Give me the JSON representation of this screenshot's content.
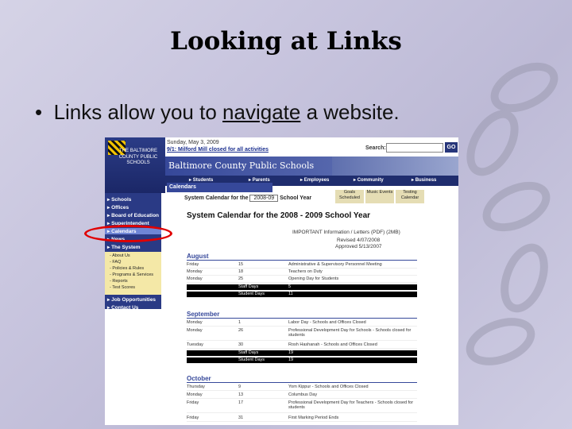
{
  "slide": {
    "title": "Looking at Links",
    "bullet_symbol": "•",
    "bullet_pre": "Links allow you to",
    "bullet_link": "navigate",
    "bullet_post": "a website."
  },
  "website": {
    "date": "Sunday, May 3, 2009",
    "alert": "9/1: Milford Mill closed for all activities",
    "search_label": "Search:",
    "search_value": "",
    "go_label": "GO",
    "logo_text": "THE BALTIMORE COUNTY PUBLIC SCHOOLS",
    "banner_title": "Baltimore County Public Schools",
    "tabs": [
      "Students",
      "Parents",
      "Employees",
      "Community",
      "Business"
    ],
    "section_title": "Calendars",
    "subtabs": [
      "Goals Scheduled",
      "Music Events",
      "Testing Calendar"
    ],
    "sidebar_items": [
      "Schools",
      "Offices",
      "Board of Education",
      "Superintendent",
      "Calendars",
      "News",
      "The System",
      "Job Opportunities",
      "Contact Us"
    ],
    "sidebar_subitems": [
      "About Us",
      "FAQ",
      "Policies & Rules",
      "Programs & Services",
      "Reports",
      "Test Scores"
    ],
    "calendar_select_label": "System Calendar for the",
    "calendar_select_value": "2008-09",
    "calendar_select_suffix": "School Year",
    "doc_title": "System Calendar for the 2008 - 2009 School Year",
    "doc_meta": [
      "IMPORTANT Information / Letters (PDF) (2MB)",
      "Revised 4/07/2008",
      "Approved 5/13/2007"
    ],
    "months": [
      {
        "name": "August",
        "rows": [
          [
            "Friday",
            "15",
            "Administrative & Supervisory Personnel Meeting"
          ],
          [
            "Monday",
            "18",
            "Teachers on Duty"
          ],
          [
            "Monday",
            "25",
            "Opening Day for Students"
          ]
        ],
        "summary": [
          [
            "Staff Days",
            "5"
          ],
          [
            "Student Days",
            "11"
          ]
        ]
      },
      {
        "name": "September",
        "rows": [
          [
            "Monday",
            "1",
            "Labor Day - Schools and Offices Closed"
          ],
          [
            "Monday",
            "26",
            "Professional Development Day for Schools - Schools closed for students"
          ],
          [
            "Tuesday",
            "30",
            "Rosh Hashanah - Schools and Offices Closed"
          ]
        ],
        "summary": [
          [
            "Staff Days",
            "19"
          ],
          [
            "Student Days",
            "19"
          ]
        ]
      },
      {
        "name": "October",
        "rows": [
          [
            "Thursday",
            "9",
            "Yom Kippur - Schools and Offices Closed"
          ],
          [
            "Monday",
            "13",
            "Columbus Day"
          ],
          [
            "Friday",
            "17",
            "Professional Development Day for Teachers - Schools closed for students"
          ],
          [
            "Friday",
            "31",
            "First Marking Period Ends"
          ]
        ]
      }
    ]
  }
}
